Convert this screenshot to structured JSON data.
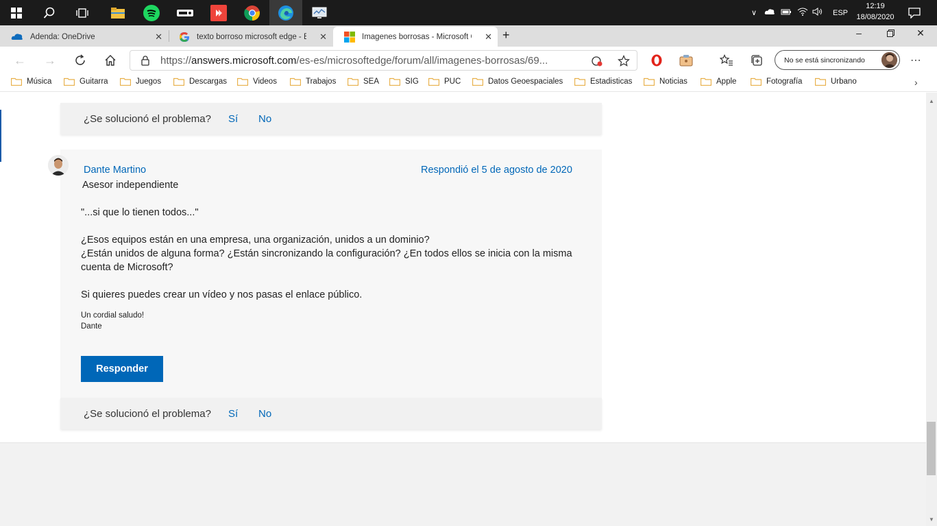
{
  "taskbar": {
    "tray_lang": "ESP",
    "time": "12:19",
    "date": "18/08/2020"
  },
  "tabs": [
    {
      "title": "Adenda: OneDrive",
      "icon": "onedrive-icon"
    },
    {
      "title": "texto borroso microsoft edge - B",
      "icon": "google-icon"
    },
    {
      "title": "Imagenes borrosas - Microsoft C",
      "icon": "microsoft-icon"
    }
  ],
  "address": {
    "url_prefix": "https://",
    "url_domain": "answers.microsoft.com",
    "url_path": "/es-es/microsoftedge/forum/all/imagenes-borrosas/69..."
  },
  "profile": {
    "sync_label": "No se está sincronizando"
  },
  "favorites": [
    "Música",
    "Guitarra",
    "Juegos",
    "Descargas",
    "Videos",
    "Trabajos",
    "SEA",
    "SIG",
    "PUC",
    "Datos Geoespaciales",
    "Estadisticas",
    "Noticias",
    "Apple",
    "Fotografía",
    "Urbano"
  ],
  "post": {
    "solved_question": "¿Se solucionó el problema?",
    "yes": "Sí",
    "no": "No",
    "author": "Dante Martino",
    "role": "Asesor independiente",
    "date": "Respondió el 5 de agosto de 2020",
    "quote": "\"...si que lo tienen todos...\"",
    "line1": "¿Esos equipos están en una empresa, una organización, unidos a un dominio?",
    "line2": "¿Están unidos de alguna forma? ¿Están sincronizando la configuración? ¿En todos ellos se inicia con la misma",
    "line3": "cuenta de Microsoft?",
    "line4": "Si quieres puedes crear un vídeo y nos pasas el enlace público.",
    "sign1": "Un cordial saludo!",
    "sign2": "Dante",
    "reply_button": "Responder"
  },
  "colors": {
    "accent": "#0067b8",
    "taskbar": "#1b1b1b",
    "folder": "#e8b04a"
  }
}
